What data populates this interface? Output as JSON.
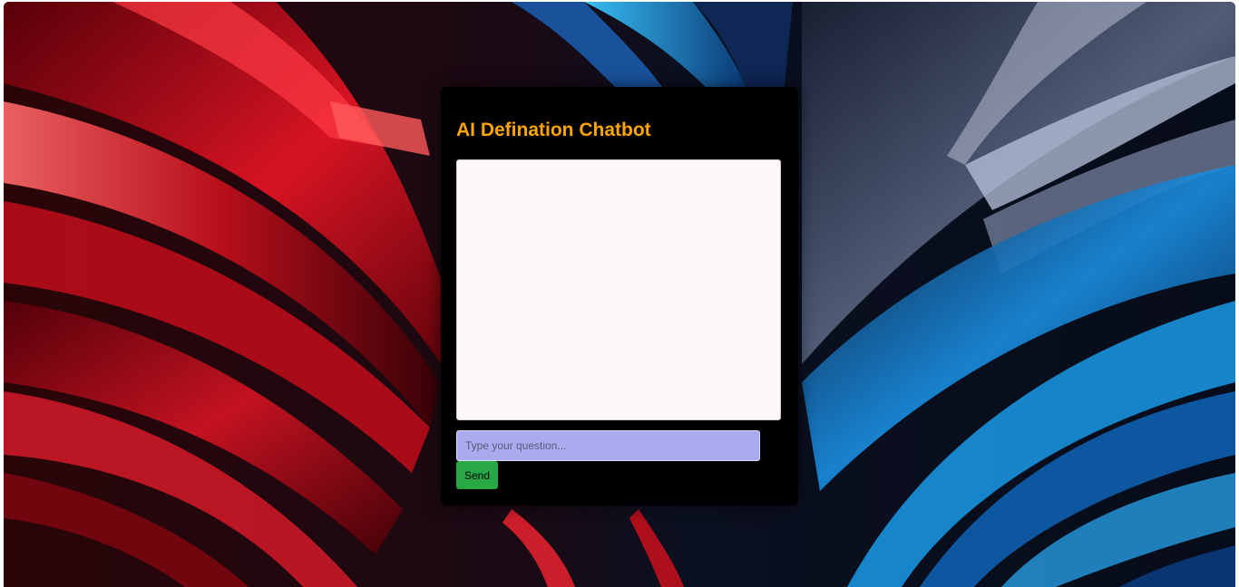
{
  "chatbot": {
    "title": "AI Defination Chatbot",
    "messages": [],
    "input": {
      "value": "",
      "placeholder": "Type your question..."
    },
    "send_label": "Send"
  },
  "colors": {
    "title": "#ffa500",
    "card_background": "#000000",
    "chat_log_background": "#fdf8f7",
    "input_background": "#aaaaef",
    "send_button": "#28a745"
  },
  "background": {
    "image": "abstract-red-blue-swirl-wallpaper"
  }
}
